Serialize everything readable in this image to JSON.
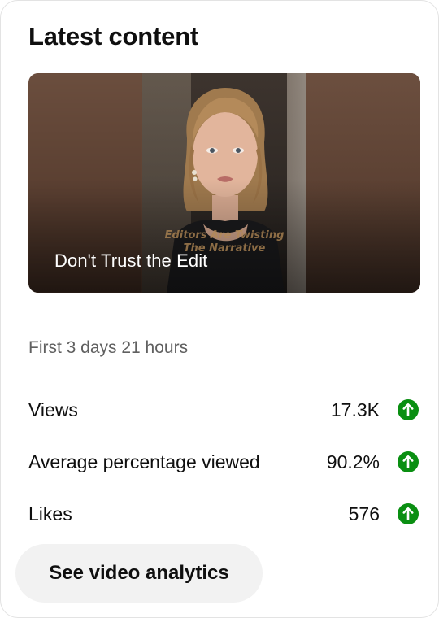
{
  "card": {
    "title": "Latest content"
  },
  "video": {
    "title": "Don't Trust the Edit",
    "overlay_caption_line1": "Editors Are Twisting",
    "overlay_caption_line2": "The Narrative"
  },
  "period": "First 3 days 21 hours",
  "metrics": [
    {
      "label": "Views",
      "value": "17.3K",
      "trend_icon": "arrow-up-circle-icon",
      "trend": "up"
    },
    {
      "label": "Average percentage viewed",
      "value": "90.2%",
      "trend_icon": "arrow-up-circle-icon",
      "trend": "up"
    },
    {
      "label": "Likes",
      "value": "576",
      "trend_icon": "arrow-up-circle-icon",
      "trend": "up"
    }
  ],
  "button": {
    "label": "See video analytics"
  },
  "colors": {
    "trend_up": "#0a8f12",
    "button_bg": "#f2f2f2",
    "secondary_text": "#606060"
  }
}
